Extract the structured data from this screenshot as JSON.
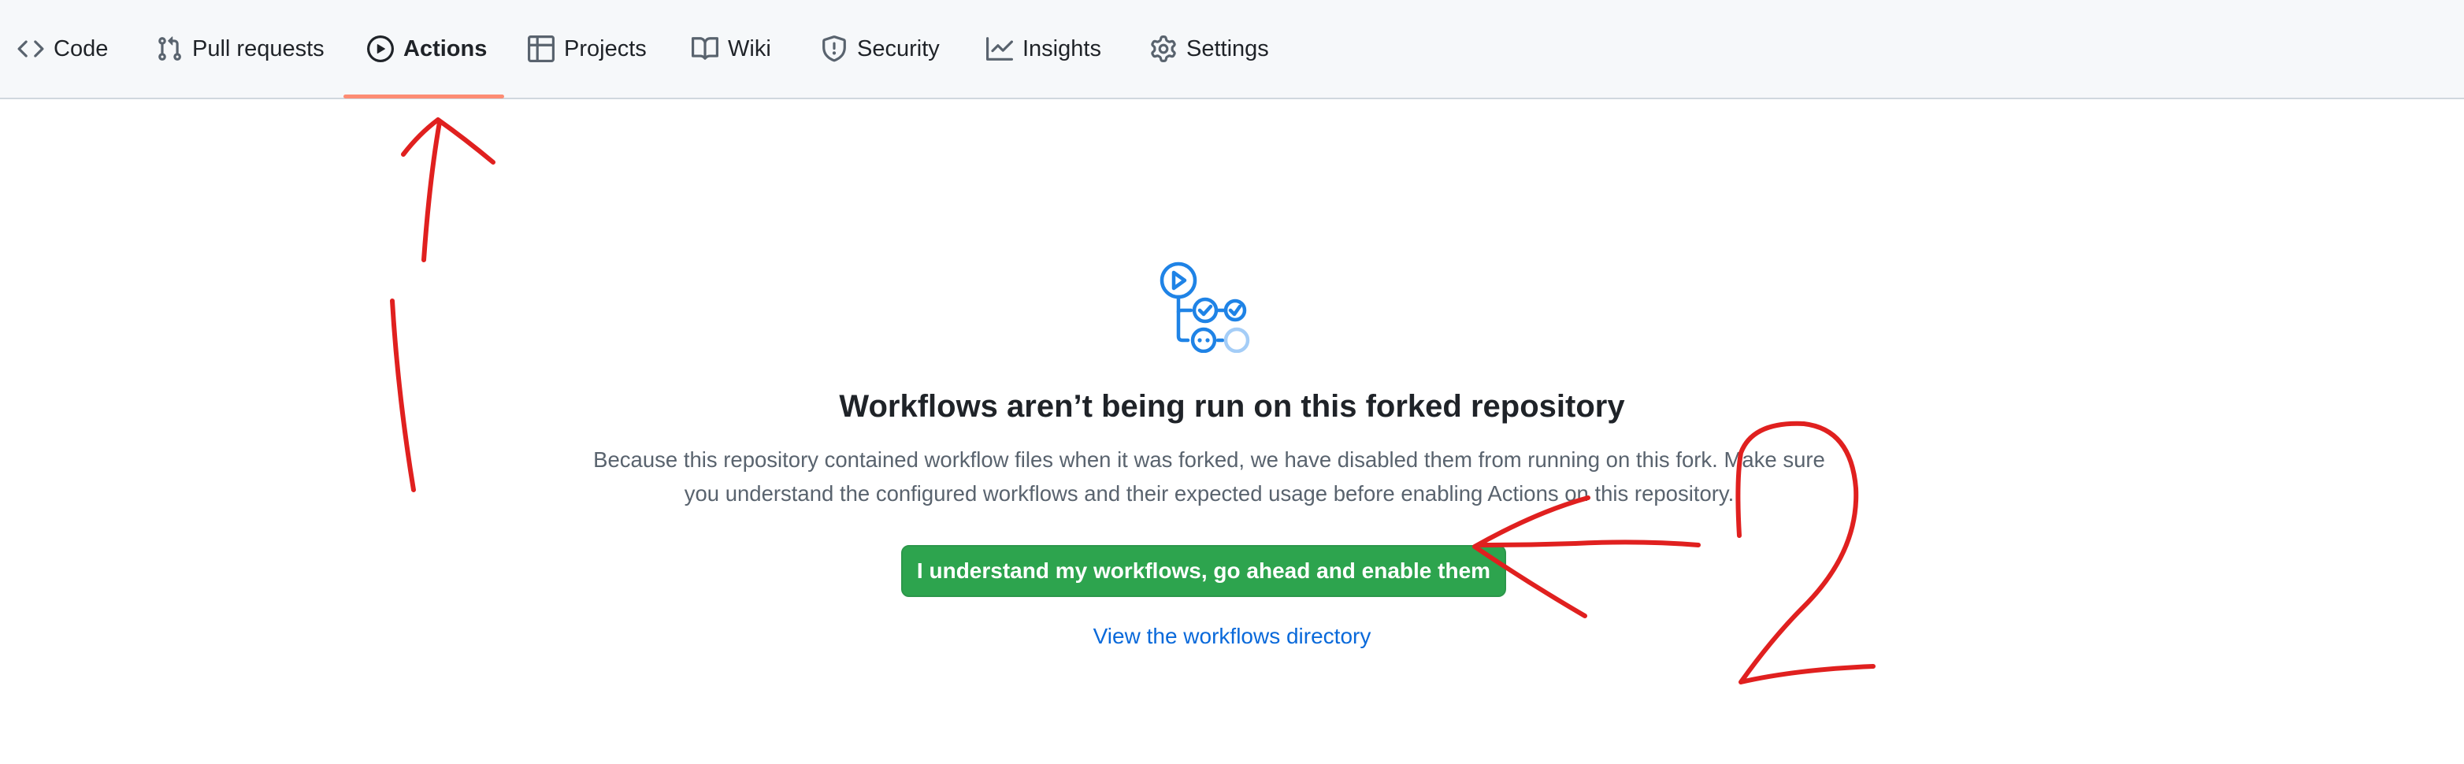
{
  "nav": {
    "items": [
      {
        "label": "Code",
        "icon": "code-icon",
        "selected": false
      },
      {
        "label": "Pull requests",
        "icon": "pull-request-icon",
        "selected": false
      },
      {
        "label": "Actions",
        "icon": "play-icon",
        "selected": true
      },
      {
        "label": "Projects",
        "icon": "table-icon",
        "selected": false
      },
      {
        "label": "Wiki",
        "icon": "book-icon",
        "selected": false
      },
      {
        "label": "Security",
        "icon": "shield-icon",
        "selected": false
      },
      {
        "label": "Insights",
        "icon": "graph-icon",
        "selected": false
      },
      {
        "label": "Settings",
        "icon": "gear-icon",
        "selected": false
      }
    ],
    "underline_color": "#fd8c73"
  },
  "blank_state": {
    "icon": "workflow-icon",
    "title": "Workflows aren’t being run on this forked repository",
    "description_line1": "Because this repository contained workflow files when it was forked, we have disabled them from running on this fork. Make sure",
    "description_line2": "you understand the configured workflows and their expected usage before enabling Actions on this repository.",
    "enable_button": "I understand my workflows, go ahead and enable them",
    "directory_link": "View the workflows directory"
  },
  "colors": {
    "primary_button": "#2da44e",
    "link": "#0969da",
    "accent_icon": "#1f83e6",
    "annotation": "#e0201f"
  },
  "annotations": {
    "step2_label": "2"
  }
}
